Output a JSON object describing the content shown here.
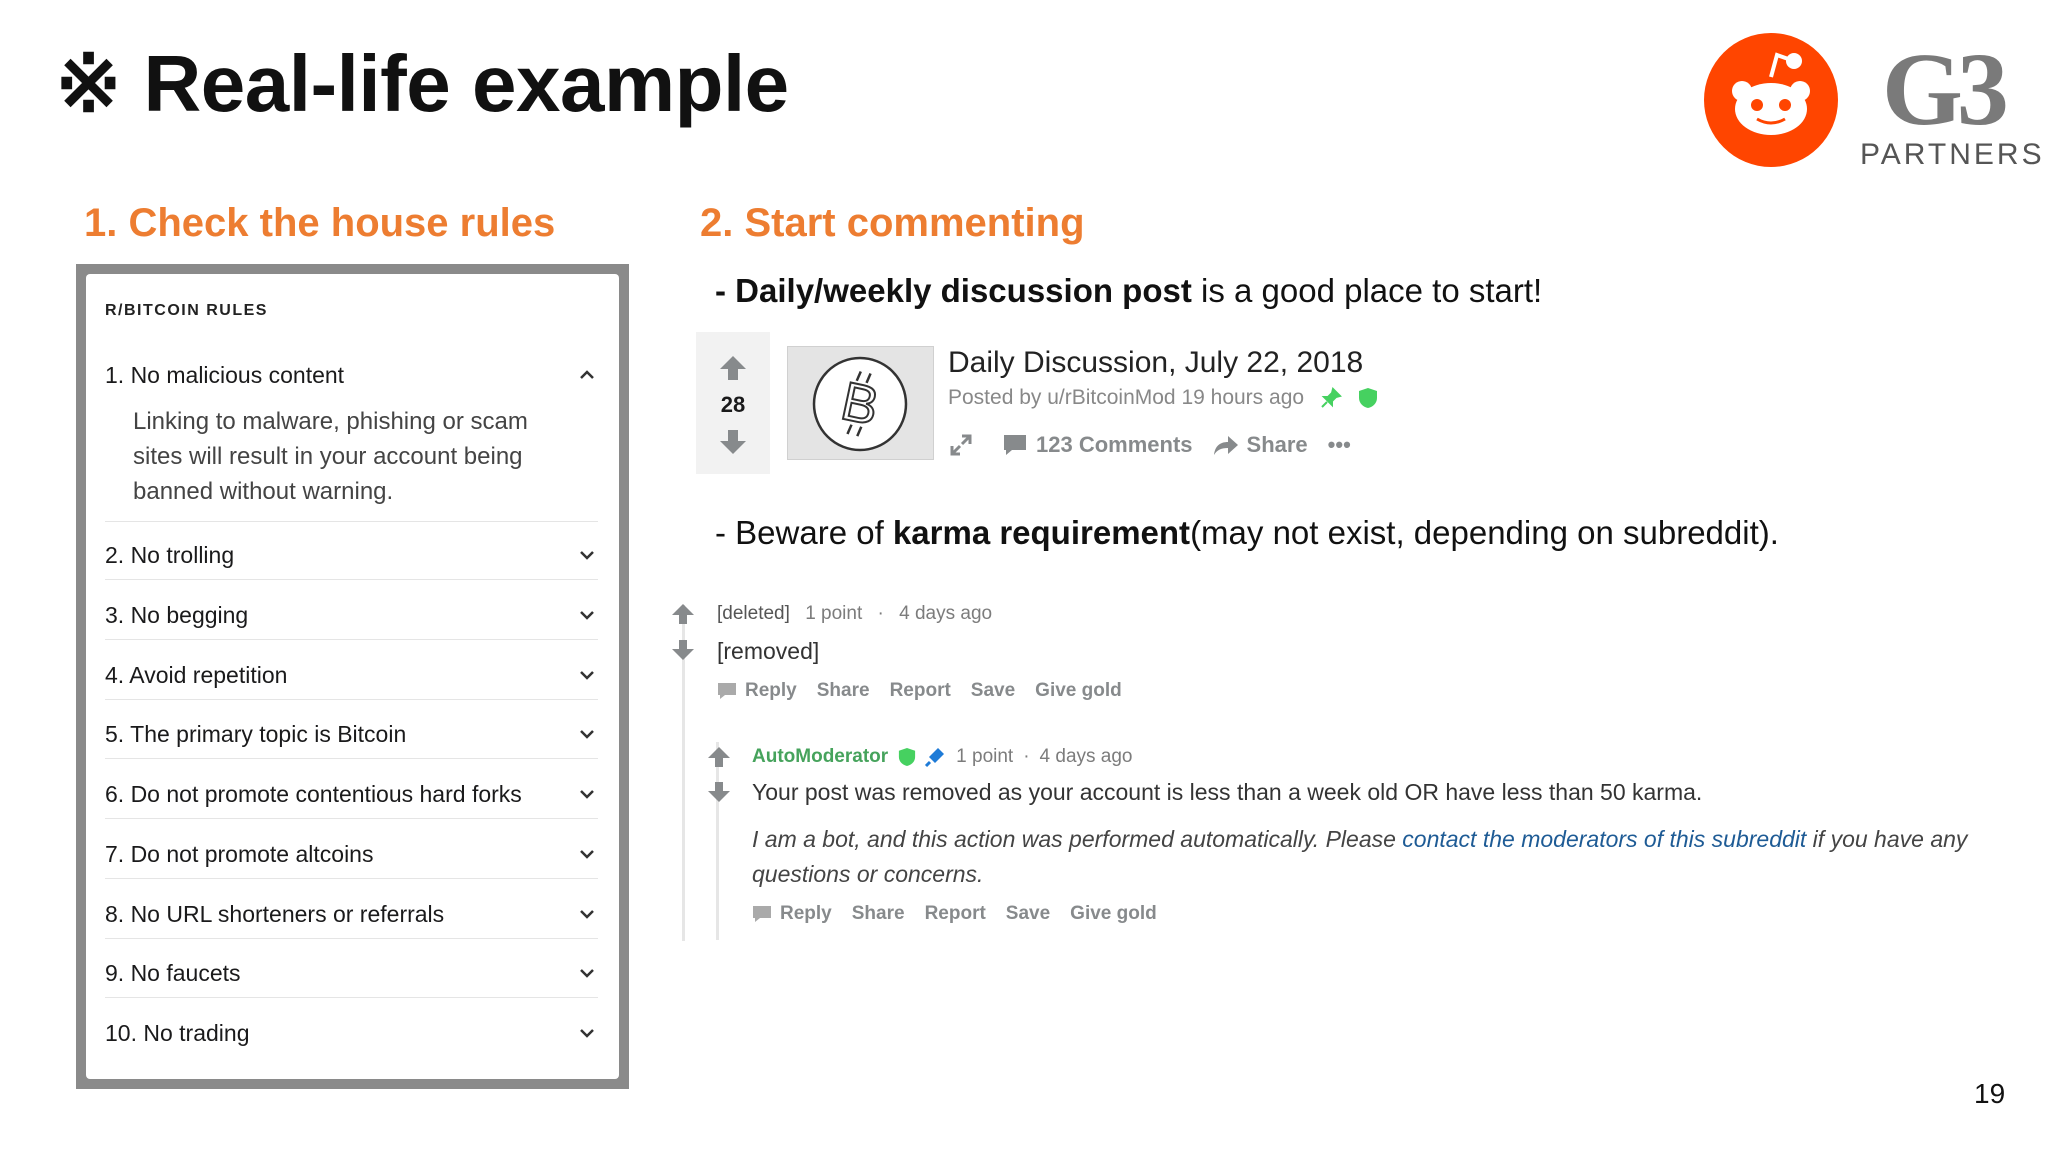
{
  "slide": {
    "title_mark": "※",
    "title": "Real-life example",
    "page_number": "19"
  },
  "logos": {
    "g3_mark": "G3",
    "g3_partners": "PARTNERS",
    "reddit_color": "#ff4500"
  },
  "accent_color": "#ed7d31",
  "section1": {
    "heading": "1. Check the house rules",
    "panel_title": "R/BITCOIN RULES",
    "rules": [
      {
        "label": "1. No malicious content",
        "expanded": true,
        "description": "Linking to malware, phishing or scam sites will result in your account being banned without warning."
      },
      {
        "label": "2. No trolling"
      },
      {
        "label": "3. No begging"
      },
      {
        "label": "4. Avoid repetition"
      },
      {
        "label": "5. The primary topic is Bitcoin"
      },
      {
        "label": "6. Do not promote contentious hard forks"
      },
      {
        "label": "7. Do not promote altcoins"
      },
      {
        "label": "8. No URL shorteners or referrals"
      },
      {
        "label": "9. No faucets"
      },
      {
        "label": "10. No trading"
      }
    ]
  },
  "section2": {
    "heading": "2. Start commenting",
    "tip1": {
      "prefix": "- ",
      "bold": "Daily/weekly discussion post",
      "rest": " is a good place to start!"
    },
    "tip2": {
      "prefix": "- Beware of ",
      "bold": "karma requirement",
      "rest": "(may not exist, depending on subreddit)."
    },
    "post": {
      "score": "28",
      "title": "Daily Discussion, July 22, 2018",
      "meta": "Posted by u/rBitcoinMod 19 hours ago",
      "comments": "123 Comments",
      "share": "Share",
      "more": "•••"
    },
    "comment1": {
      "author": "[deleted]",
      "points": "1 point",
      "dot": "·",
      "age": "4 days ago",
      "body": "[removed]",
      "actions": [
        "Reply",
        "Share",
        "Report",
        "Save",
        "Give gold"
      ]
    },
    "comment2": {
      "author": "AutoModerator",
      "points": "1 point",
      "dot": "·",
      "age": "4 days ago",
      "body": "Your post was removed as your account is less than a week old OR have less than 50 karma.",
      "note_prefix": "I am a bot, and this action was performed automatically. Please ",
      "note_link": "contact the moderators of this subreddit",
      "note_suffix": " if you have any questions or concerns.",
      "actions": [
        "Reply",
        "Share",
        "Report",
        "Save",
        "Give gold"
      ]
    }
  }
}
